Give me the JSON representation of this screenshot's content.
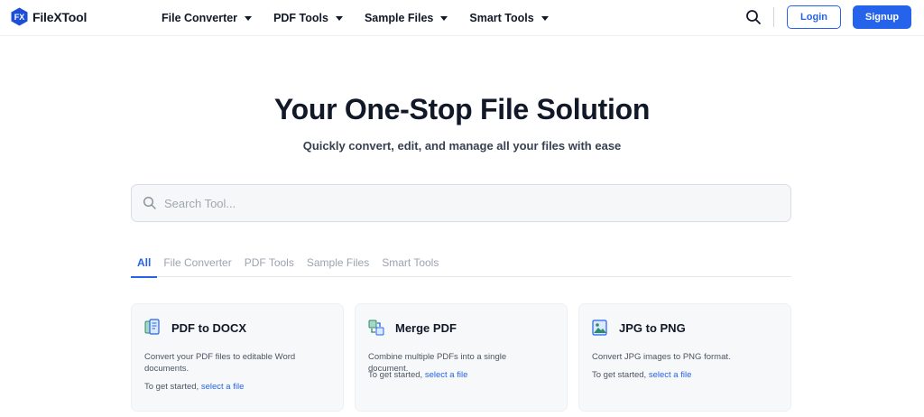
{
  "brand": {
    "name": "FileXTool",
    "badge": "FX",
    "color": "#2563eb"
  },
  "nav": [
    {
      "label": "File Converter"
    },
    {
      "label": "PDF Tools"
    },
    {
      "label": "Sample Files"
    },
    {
      "label": "Smart Tools"
    }
  ],
  "header": {
    "search_icon": "search-icon",
    "login_label": "Login",
    "signup_label": "Signup"
  },
  "hero": {
    "title": "Your One-Stop File Solution",
    "subtitle": "Quickly convert, edit, and manage all your files with ease"
  },
  "search": {
    "placeholder": "Search Tool..."
  },
  "tabs": [
    {
      "label": "All",
      "active": true
    },
    {
      "label": "File Converter",
      "active": false
    },
    {
      "label": "PDF Tools",
      "active": false
    },
    {
      "label": "Sample Files",
      "active": false
    },
    {
      "label": "Smart Tools",
      "active": false
    }
  ],
  "cards": [
    {
      "title": "PDF to DOCX",
      "icon": "pdf-to-docx-icon",
      "description": "Convert your PDF files to editable Word documents.",
      "start_text": "To get started,",
      "link_text": "select a file"
    },
    {
      "title": "Merge PDF",
      "icon": "merge-pdf-icon",
      "description": "Combine multiple PDFs into a single document.",
      "start_text": "To get started,",
      "link_text": "select a file"
    },
    {
      "title": "JPG to PNG",
      "icon": "jpg-to-png-icon",
      "description": "Convert JPG images to PNG format.",
      "start_text": "To get started,",
      "link_text": "select a file"
    }
  ]
}
